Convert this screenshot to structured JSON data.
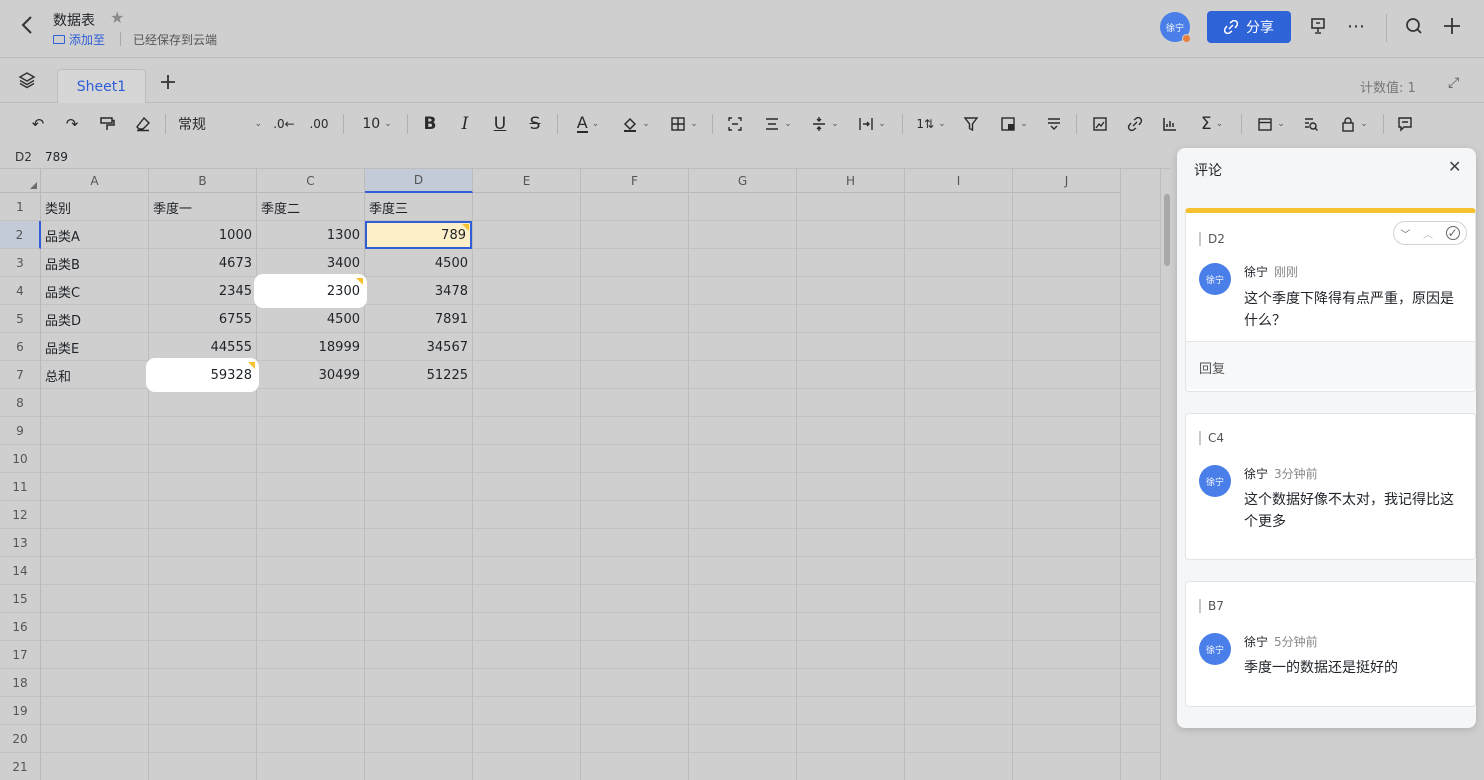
{
  "header": {
    "title": "数据表",
    "add_to": "添加至",
    "saved_status": "已经保存到云端",
    "avatar_text": "徐宁",
    "share_label": "分享",
    "icons": [
      "back-arrow-icon",
      "star-icon",
      "folder-icon",
      "share-link-icon",
      "present-icon",
      "more-icon",
      "search-icon",
      "plus-icon"
    ]
  },
  "tabs": {
    "sheet_name": "Sheet1",
    "count_label": "计数值: 1"
  },
  "toolbar": {
    "format": "常规",
    "font_size": "10"
  },
  "formula_bar": {
    "cell_ref": "D2",
    "value": "789"
  },
  "grid": {
    "columns": [
      "A",
      "B",
      "C",
      "D",
      "E",
      "F",
      "G",
      "H",
      "I",
      "J"
    ],
    "rows": [
      "1",
      "2",
      "3",
      "4",
      "5",
      "6",
      "7",
      "8",
      "9",
      "10",
      "11",
      "12",
      "13",
      "14",
      "15",
      "16",
      "17",
      "18",
      "19",
      "20",
      "21"
    ],
    "selected_cell": "D2",
    "data": [
      [
        "类别",
        "季度一",
        "季度二",
        "季度三"
      ],
      [
        "品类A",
        "1000",
        "1300",
        "789"
      ],
      [
        "品类B",
        "4673",
        "3400",
        "4500"
      ],
      [
        "品类C",
        "2345",
        "2300",
        "3478"
      ],
      [
        "品类D",
        "6755",
        "4500",
        "7891"
      ],
      [
        "品类E",
        "44555",
        "18999",
        "34567"
      ],
      [
        "总和",
        "59328",
        "30499",
        "51225"
      ]
    ],
    "commented_cells": [
      "D2",
      "C4",
      "B7"
    ]
  },
  "comments_panel": {
    "title": "评论",
    "reply_label": "回复",
    "comments": [
      {
        "ref": "D2",
        "author": "徐宁",
        "time": "刚刚",
        "text": "这个季度下降得有点严重，原因是什么？"
      },
      {
        "ref": "C4",
        "author": "徐宁",
        "time": "3分钟前",
        "text": "这个数据好像不太对，我记得比这个更多"
      },
      {
        "ref": "B7",
        "author": "徐宁",
        "time": "5分钟前",
        "text": "季度一的数据还是挺好的"
      }
    ]
  },
  "colors": {
    "accent": "#2f63d8",
    "comment_flag": "#f5c12e",
    "active_cell_fill": "#fdf0c9"
  }
}
